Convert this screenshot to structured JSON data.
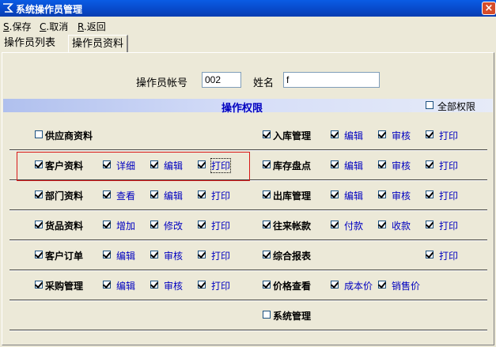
{
  "window": {
    "title": "系统操作员管理",
    "close_glyph": "×"
  },
  "menu": [
    {
      "key": "S",
      "label": ".保存"
    },
    {
      "key": "C",
      "label": ".取消"
    },
    {
      "key": "R",
      "label": ".返回"
    }
  ],
  "tabs": [
    {
      "label": "操作员列表",
      "active": false
    },
    {
      "label": "操作员资料",
      "active": true
    }
  ],
  "form": {
    "account_label": "操作员帐号",
    "account_value": "002",
    "name_label": "姓名",
    "name_value": "f"
  },
  "section": {
    "title": "操作权限",
    "all_label": "全部权限",
    "all_checked": false
  },
  "rows": [
    {
      "left": {
        "module": "供应商资料",
        "checked": false,
        "perms": []
      },
      "right": {
        "module": "入库管理",
        "checked": true,
        "perms": [
          {
            "label": "编辑",
            "checked": true
          },
          {
            "label": "审核",
            "checked": true
          },
          {
            "label": "打印",
            "checked": true
          }
        ]
      }
    },
    {
      "left": {
        "module": "客户资料",
        "checked": true,
        "perms": [
          {
            "label": "详细",
            "checked": true
          },
          {
            "label": "编辑",
            "checked": true
          },
          {
            "label": "打印",
            "checked": true
          }
        ]
      },
      "right": {
        "module": "库存盘点",
        "checked": true,
        "perms": [
          {
            "label": "编辑",
            "checked": true
          },
          {
            "label": "审核",
            "checked": true
          },
          {
            "label": "打印",
            "checked": true
          }
        ]
      }
    },
    {
      "left": {
        "module": "部门资料",
        "checked": true,
        "perms": [
          {
            "label": "查看",
            "checked": true
          },
          {
            "label": "编辑",
            "checked": true
          },
          {
            "label": "打印",
            "checked": true
          }
        ]
      },
      "right": {
        "module": "出库管理",
        "checked": true,
        "perms": [
          {
            "label": "编辑",
            "checked": true
          },
          {
            "label": "审核",
            "checked": true
          },
          {
            "label": "打印",
            "checked": true
          }
        ]
      }
    },
    {
      "left": {
        "module": "货品资料",
        "checked": true,
        "perms": [
          {
            "label": "增加",
            "checked": true
          },
          {
            "label": "修改",
            "checked": true
          },
          {
            "label": "打印",
            "checked": true
          }
        ]
      },
      "right": {
        "module": "往来帐款",
        "checked": true,
        "perms": [
          {
            "label": "付款",
            "checked": true
          },
          {
            "label": "收款",
            "checked": true
          },
          {
            "label": "打印",
            "checked": true
          }
        ]
      }
    },
    {
      "left": {
        "module": "客户订单",
        "checked": true,
        "perms": [
          {
            "label": "编辑",
            "checked": true
          },
          {
            "label": "审核",
            "checked": true
          },
          {
            "label": "打印",
            "checked": true
          }
        ]
      },
      "right": {
        "module": "综合报表",
        "checked": true,
        "perms": [
          null,
          null,
          {
            "label": "打印",
            "checked": true
          }
        ]
      }
    },
    {
      "left": {
        "module": "采购管理",
        "checked": true,
        "perms": [
          {
            "label": "编辑",
            "checked": true
          },
          {
            "label": "审核",
            "checked": true
          },
          {
            "label": "打印",
            "checked": true
          }
        ]
      },
      "right": {
        "module": "价格查看",
        "checked": true,
        "perms": [
          {
            "label": "成本价",
            "checked": true
          },
          {
            "label": "销售价",
            "checked": true
          }
        ]
      }
    },
    {
      "left": null,
      "right": {
        "module": "系统管理",
        "checked": false,
        "perms": []
      }
    }
  ]
}
